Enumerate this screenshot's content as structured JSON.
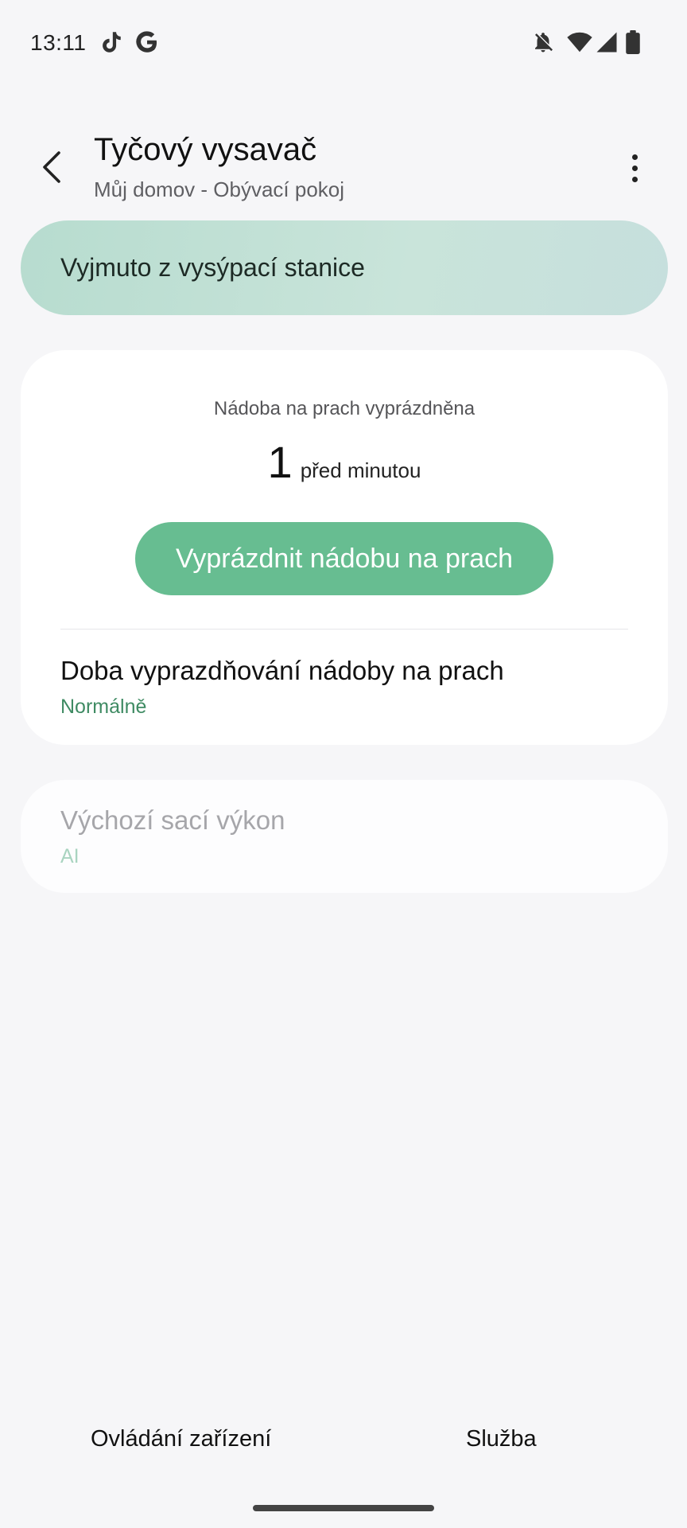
{
  "status_bar": {
    "time": "13:11",
    "left_icons": [
      "tiktok-icon",
      "google-icon"
    ],
    "right_icons": [
      "notifications-off-icon",
      "wifi-icon",
      "cell-signal-icon",
      "battery-icon"
    ]
  },
  "header": {
    "title": "Tyčový vysavač",
    "subtitle": "Můj domov - Obývací pokoj"
  },
  "banner": {
    "text": "Vyjmuto z vysýpací stanice"
  },
  "dust_bin": {
    "label": "Nádoba na prach vyprázdněna",
    "value": "1",
    "unit": "před minutou",
    "empty_button_label": "Vyprázdnit nádobu na prach"
  },
  "settings": {
    "emptying_time": {
      "title": "Doba vyprazdňování nádoby na prach",
      "value": "Normálně"
    },
    "suction_power": {
      "title": "Výchozí sací výkon",
      "value": "AI"
    }
  },
  "bottom_nav": {
    "device_control": "Ovládání zařízení",
    "service": "Služba"
  },
  "colors": {
    "accent": "#67bd91",
    "accent_text": "#3f8b63",
    "banner": "#c2e1d5",
    "background": "#f6f6f8"
  }
}
